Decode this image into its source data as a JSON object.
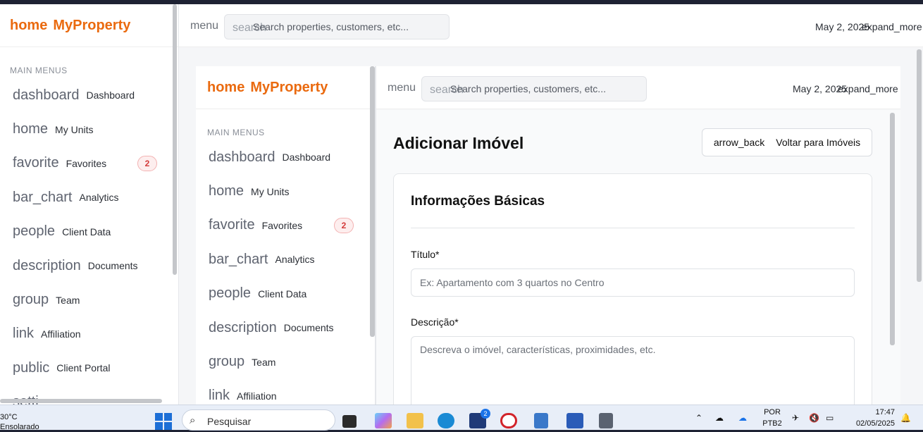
{
  "app": {
    "brand_icon": "home",
    "brand_name": "MyProperty",
    "brand_color": "#ea6a0f"
  },
  "sidebar": {
    "section_title": "MAIN MENUS",
    "items": [
      {
        "icon": "dashboard",
        "label": "Dashboard"
      },
      {
        "icon": "home",
        "label": "My Units"
      },
      {
        "icon": "favorite",
        "label": "Favorites",
        "badge": "2"
      },
      {
        "icon": "bar_chart",
        "label": "Analytics"
      },
      {
        "icon": "people",
        "label": "Client Data"
      },
      {
        "icon": "description",
        "label": "Documents"
      },
      {
        "icon": "group",
        "label": "Team"
      },
      {
        "icon": "link",
        "label": "Affiliation"
      },
      {
        "icon": "public",
        "label": "Client Portal"
      },
      {
        "icon": "setti",
        "label": ""
      }
    ]
  },
  "header": {
    "menu_icon": "menu",
    "search_icon": "search",
    "search_placeholder": "Search properties, customers, etc...",
    "date": "May 2, 2025",
    "expand_icon": "expand_more"
  },
  "page": {
    "title": "Adicionar Imóvel",
    "back_icon": "arrow_back",
    "back_label": "Voltar para Imóveis",
    "card_title": "Informações Básicas",
    "title_label": "Título*",
    "title_placeholder": "Ex: Apartamento com 3 quartos no Centro",
    "desc_label": "Descrição*",
    "desc_placeholder": "Descreva o imóvel, características, proximidades, etc."
  },
  "taskbar": {
    "weather_temp": "30°C",
    "weather_desc": "Ensolarado",
    "search_label": "Pesquisar",
    "lang": "POR",
    "lang_sub": "PTB2",
    "time": "17:47",
    "date": "02/05/2025",
    "app_badge": "2"
  }
}
